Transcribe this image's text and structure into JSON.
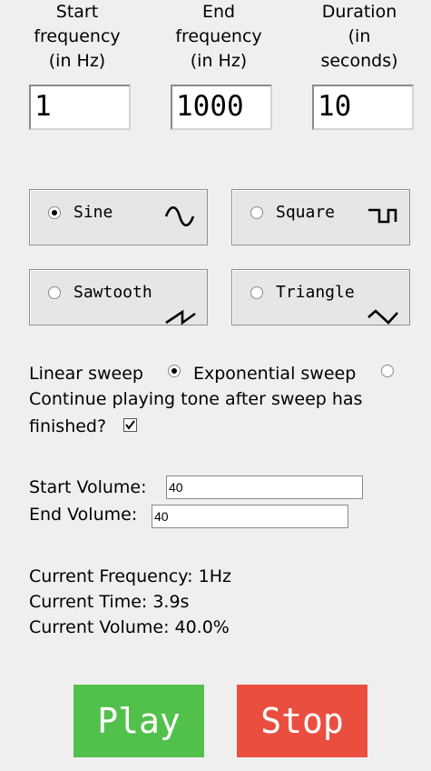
{
  "headers": {
    "start": "Start\nfrequency\n(in Hz)",
    "end": "End\nfrequency\n(in Hz)",
    "duration": "Duration\n(in\nseconds)"
  },
  "inputs": {
    "start_frequency": "1",
    "end_frequency": "1000",
    "duration": "10"
  },
  "waveforms": {
    "sine": "Sine",
    "square": "Square",
    "sawtooth": "Sawtooth",
    "triangle": "Triangle",
    "selected": "sine"
  },
  "sweep": {
    "linear_label": "Linear sweep",
    "exponential_label": "Exponential sweep",
    "selected": "linear",
    "continue_label_line1": "Continue playing tone after sweep has",
    "continue_label_line2": "finished?",
    "continue_checked": true
  },
  "volume": {
    "start_label": "Start Volume:",
    "start_value": "40",
    "end_label": "End Volume:",
    "end_value": "40"
  },
  "status": {
    "frequency": "Current Frequency: 1Hz",
    "time": "Current Time: 3.9s",
    "volume": "Current Volume: 40.0%"
  },
  "buttons": {
    "play": "Play",
    "stop": "Stop",
    "play_color": "#52c14c",
    "stop_color": "#ea4e3f"
  }
}
